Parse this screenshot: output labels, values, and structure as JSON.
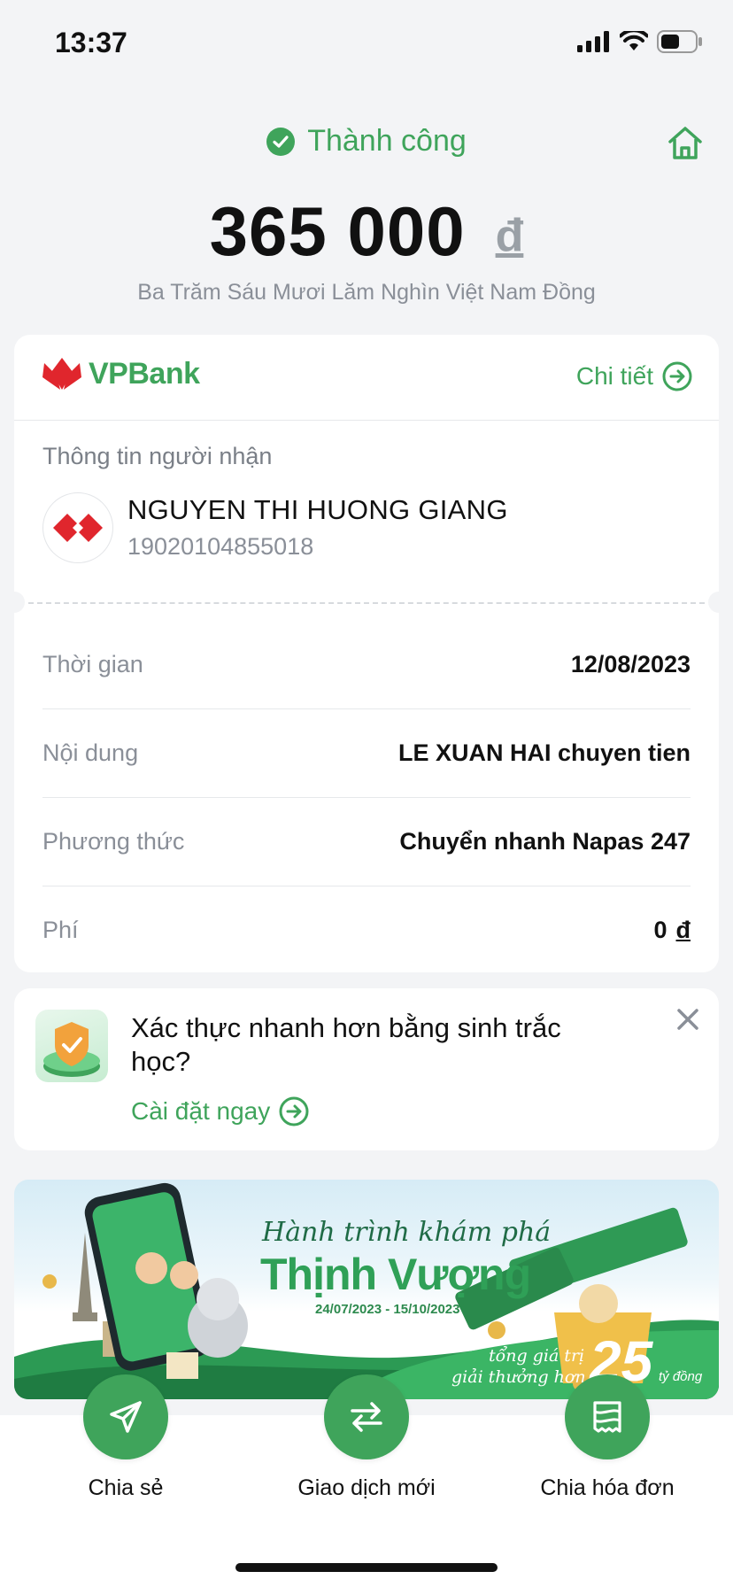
{
  "status_bar": {
    "time": "13:37"
  },
  "header": {
    "status": "Thành công",
    "amount": "365 000",
    "currency": "đ",
    "amount_words": "Ba Trăm Sáu Mươi Lăm Nghìn Việt Nam Đồng"
  },
  "card": {
    "bank_name": "VPBank",
    "detail_label": "Chi tiết",
    "recipient_label": "Thông tin người nhận",
    "recipient_name": "NGUYEN THI HUONG GIANG",
    "recipient_account": "19020104855018",
    "rows": [
      {
        "label": "Thời gian",
        "value": "12/08/2023"
      },
      {
        "label": "Nội dung",
        "value": "LE XUAN HAI chuyen tien"
      },
      {
        "label": "Phương thức",
        "value": "Chuyển nhanh Napas 247"
      },
      {
        "label": "Phí",
        "value": "0",
        "currency": "đ"
      }
    ]
  },
  "biometric": {
    "title": "Xác thực nhanh hơn bằng sinh trắc học?",
    "link": "Cài đặt ngay"
  },
  "banner": {
    "title_line1": "Hành trình khám phá",
    "title_line2": "Thịnh Vượng",
    "date_range": "24/07/2023 - 15/10/2023",
    "footer_line1": "tổng giá trị",
    "footer_line2": "giải thưởng hơn",
    "prize_number": "25",
    "prize_unit": "tỷ đồng"
  },
  "actions": [
    {
      "label": "Chia sẻ",
      "icon": "send-icon"
    },
    {
      "label": "Giao dịch mới",
      "icon": "swap-icon"
    },
    {
      "label": "Chia hóa đơn",
      "icon": "receipt-icon"
    }
  ],
  "colors": {
    "accent": "#3fa45b",
    "muted": "#8a8f98",
    "brand_red": "#e0262d"
  }
}
